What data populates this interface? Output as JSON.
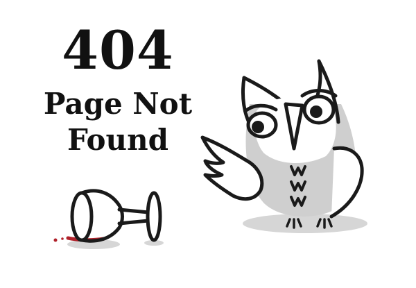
{
  "error": {
    "code": "404",
    "message": "Page Not Found"
  },
  "colors": {
    "text": "#111111",
    "ink": "#1a1a1a",
    "owl_shade": "#cfcfcf",
    "shadow": "#d6d6d6",
    "wine": "#b0212a"
  },
  "icons": {
    "glass": "tipped-wine-glass-icon",
    "owl": "owl-mascot-icon"
  }
}
